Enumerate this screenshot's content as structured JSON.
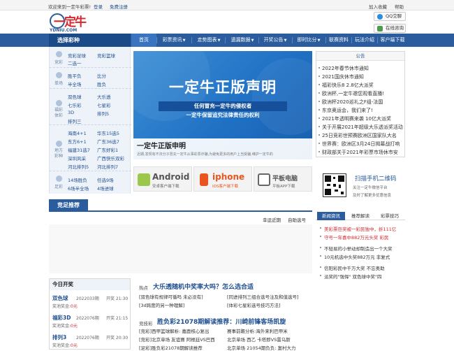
{
  "topbar": {
    "welcome": "欢迎来到一定牛彩票!",
    "login": "登录",
    "register": "免费注册",
    "favorite": "加入收藏",
    "help": "帮助"
  },
  "logo": {
    "text": "一定牛",
    "domain": "YDNIU.COM"
  },
  "header_buttons": {
    "qq": "QQ交聊",
    "online": "在线咨询"
  },
  "nav": {
    "select_title": "选择彩种",
    "items": [
      "首页",
      "彩票资讯",
      "走势图表",
      "遗漏数据",
      "开奖公告",
      "即时比分",
      "联赛资料",
      "玩法介绍",
      "客户端下载"
    ]
  },
  "sidebar": {
    "groups": [
      {
        "icon": "竞彩",
        "links": [
          "竞彩足球",
          "竞彩篮球",
          "二选一"
        ]
      },
      {
        "icon": "单场",
        "links": [
          "胜平负",
          "比分",
          "半全场",
          "胜负"
        ]
      },
      {
        "icon": "福彩体彩",
        "links": [
          "双色球",
          "大乐透",
          "七乐彩",
          "七星彩",
          "3D",
          "排列5",
          "排列三"
        ]
      },
      {
        "icon": "地方彩种",
        "links": [
          "海南4+1",
          "华东15选5",
          "东方6+1",
          "广东36选7",
          "福建31选7",
          "广东好彩1",
          "深圳风采",
          "广西快乐双彩",
          "河北排列5",
          "河北排列7"
        ]
      },
      {
        "icon": "足彩",
        "links": [
          "14场胜负",
          "任选9场",
          "6场半全场",
          "4场进球"
        ]
      }
    ]
  },
  "banner": {
    "title": "一定牛正版声明",
    "line1": "任何冒充一定牛的侵权者",
    "line2": "一定牛保留追究法律责任的权利",
    "caption": "一定牛正版申明",
    "desc": "近期,发现有不法分子冒充一定牛从事彩票诈骗,为避免更多的用户上当受骗,维护一定牛的"
  },
  "apps": [
    {
      "name": "Android",
      "desc": "安卓客户端下载"
    },
    {
      "name": "iphone",
      "desc": "IOS客户端下载"
    },
    {
      "name": "平板电脑",
      "desc": "平板APP下载"
    }
  ],
  "notice": {
    "title": "公告",
    "items": [
      "2022年春节休市通知",
      "2021国庆休市通知",
      "福彩快乐8 2.8亿大派奖",
      "欧洲杯,一定牛邀您观看直播!",
      "欧洲杯2020巡礼之F组-法国",
      "东京奥运会，我们来了!",
      "2021年透明赛来袭 10亿大派奖",
      "关于开展2021年超级大乐透派奖活动",
      "25日竞彩世预赛欧洲区国家队大名",
      "世界赛：欧洲区3月24日揭幕战打响",
      "财政部关于2021年彩票市场休市安"
    ]
  },
  "qr": {
    "title": "扫描手机二维码",
    "desc1": "关注一定牛微信平台",
    "desc2": "及时了解更多优惠信息"
  },
  "side_tabs": {
    "tabs": [
      "新闻资讯",
      "推荐解读",
      "彩票技巧"
    ]
  },
  "side_news": [
    "美彩票巨奖被一彩民独中，折111亿",
    "守号一年喜中882万元头奖 彩民",
    "不轻易的小举动却制造出一个大奖",
    "10元机选中头奖882万元 非复式",
    "信阳彩民中千万大奖 不忘奥助",
    "派奖的\"强悍\" 双色球中奖\"四"
  ],
  "recommend": {
    "title": "竞足推荐",
    "sub1": "幸运近期",
    "sub2": "自助选号"
  },
  "today": {
    "title": "今日开奖",
    "rows": [
      {
        "name": "双色球",
        "issue": "2022033期",
        "time": "开奖 21:30",
        "prize_label": "奖池奖金:",
        "prize": "0元"
      },
      {
        "name": "福彩3D",
        "issue": "2022076期",
        "time": "开奖 21:15",
        "prize_label": "奖池奖金:",
        "prize": "0元"
      },
      {
        "name": "排列3",
        "issue": "2022076期",
        "time": "开奖 20:30",
        "prize_label": "奖池奖金:",
        "prize": "0元"
      }
    ]
  },
  "hot": {
    "label": "热点",
    "title": "大乐透随机中奖率大吗？怎么选合适",
    "links_left": [
      "[双色球有规律可循吗 未必没有]",
      "[3d跨度的另一种理解]"
    ],
    "links_right": [
      "[同进排列三组合选号注及和值选号]",
      "[体彩七星彩选号技巧方法]"
    ],
    "label2": "竞技彩",
    "title2": "胜负彩21078期解读推荐：川崎前锋客场凯旋",
    "rows": [
      {
        "left": "[竞彩]西甲篮球解析: 嘉鹿核心复出",
        "right": "赛事前瞻分析:海外来利巴甲米"
      },
      {
        "left": "[竞彩]北京单场 友谊赛 阿根廷VS巴西",
        "right": "北京单场 西乙 卡塔即VS雷乌斯"
      },
      {
        "left": "[足彩]胜负彩21078期解读推荐",
        "right": "北京单场 21054期负负: 富村大力"
      }
    ]
  },
  "colors": {
    "nav_blue": "#2a5c9e",
    "red_accent": "#d6262d",
    "android_green": "#9bc84a",
    "iphone_orange": "#e8551f"
  }
}
